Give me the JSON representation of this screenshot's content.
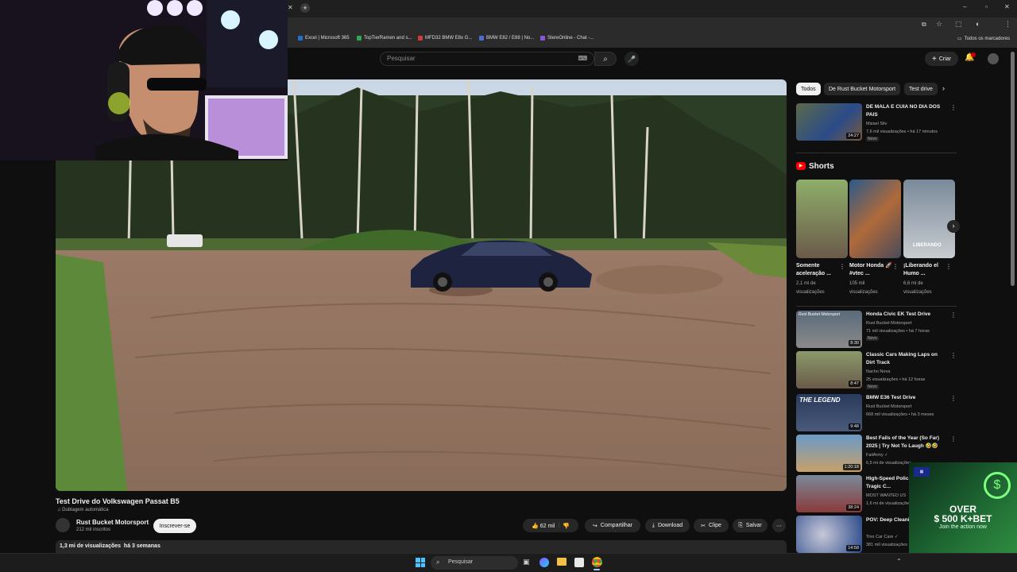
{
  "browser": {
    "bookmarks": [
      {
        "label": "Excel | Microsoft 365",
        "color": "#1f6fd1"
      },
      {
        "label": "TopTierRamen and s...",
        "color": "#2fa84f"
      },
      {
        "label": "MFD32 BMW E8x G...",
        "color": "#d23b3b"
      },
      {
        "label": "BMW E82 / E88 | No...",
        "color": "#4a6fd1"
      },
      {
        "label": "StereOnline - Chat -...",
        "color": "#8a55d6"
      }
    ],
    "all_bookmarks": "Todos os marcadores"
  },
  "youtube": {
    "search_placeholder": "Pesquisar",
    "create_label": "Criar",
    "notification_count": "9+"
  },
  "video": {
    "title": "Test Drive do Volkswagen Passat B5",
    "dubbing": "Dublagem automática",
    "channel": "Rust Bucket Motorsport",
    "subscribers": "212 mil inscritos",
    "subscribe_label": "Inscrever-se",
    "likes": "62 mil",
    "share_label": "Compartilhar",
    "download_label": "Download",
    "clip_label": "Clipe",
    "save_label": "Salvar",
    "views_line": "1,3 mi de visualizações  há 3 semanas"
  },
  "chips": [
    "Todos",
    "De Rust Bucket Motorsport",
    "Test drive"
  ],
  "first_rec": {
    "title": "DE MALA E CUIA NO DIA DOS PAIS",
    "channel": "Mizael Silv",
    "meta": "7,6 mil visualizações • há 17 minutos",
    "badge": "Novo",
    "duration": "24:27"
  },
  "shorts": {
    "heading": "Shorts",
    "items": [
      {
        "title": "Somente aceleração ...",
        "views": "2,1 mi de visualizações"
      },
      {
        "title": "Motor Honda 🚀 #vtec ...",
        "views": "105 mil visualizações"
      },
      {
        "title": "¡Liberando el Humo ...",
        "views": "6,6 mi de visualizações",
        "overlay": "LIBERANDO"
      }
    ]
  },
  "recommendations": [
    {
      "title": "Honda Civic EK Test Drive",
      "channel": "Rust Bucket Motorsport",
      "meta": "71 mil visualizações • há 7 horas",
      "badge": "Novo",
      "duration": "8:30",
      "overlay": "Rust Bucket Motorsport"
    },
    {
      "title": "Classic Cars Making Laps on Dirt Track",
      "channel": "Nacho Nova",
      "meta": "25 visualizações • há 12 horas",
      "badge": "Novo",
      "duration": "8:47"
    },
    {
      "title": "BMW E36 Test Drive",
      "channel": "Rust Bucket Motorsport",
      "meta": "668 mil visualizações • há 3 meses",
      "duration": "9:48",
      "overlay": "THE LEGEND"
    },
    {
      "title": "Best Fails of the Year (So Far) 2025 | Try Not To Laugh 🤣🤣",
      "channel": "FailArmy ✓",
      "meta": "6,5 mi de visualizações",
      "duration": "1:20:18"
    },
    {
      "title": "High-Speed Polic... Ended In Tragic C...",
      "channel": "MOST WANTED US",
      "meta": "1,6 mi de visualizações",
      "duration": "38:24"
    },
    {
      "title": "POV: Deep Cleani... Vehicle",
      "channel": "Tino Car Care ✓",
      "meta": "381 mil visualizações",
      "duration": "14:58"
    }
  ],
  "ad": {
    "headline": "OVER",
    "amount": "$ 500 K+BET",
    "sub": "Join the action now"
  },
  "taskbar": {
    "search_placeholder": "Pesquisar"
  }
}
